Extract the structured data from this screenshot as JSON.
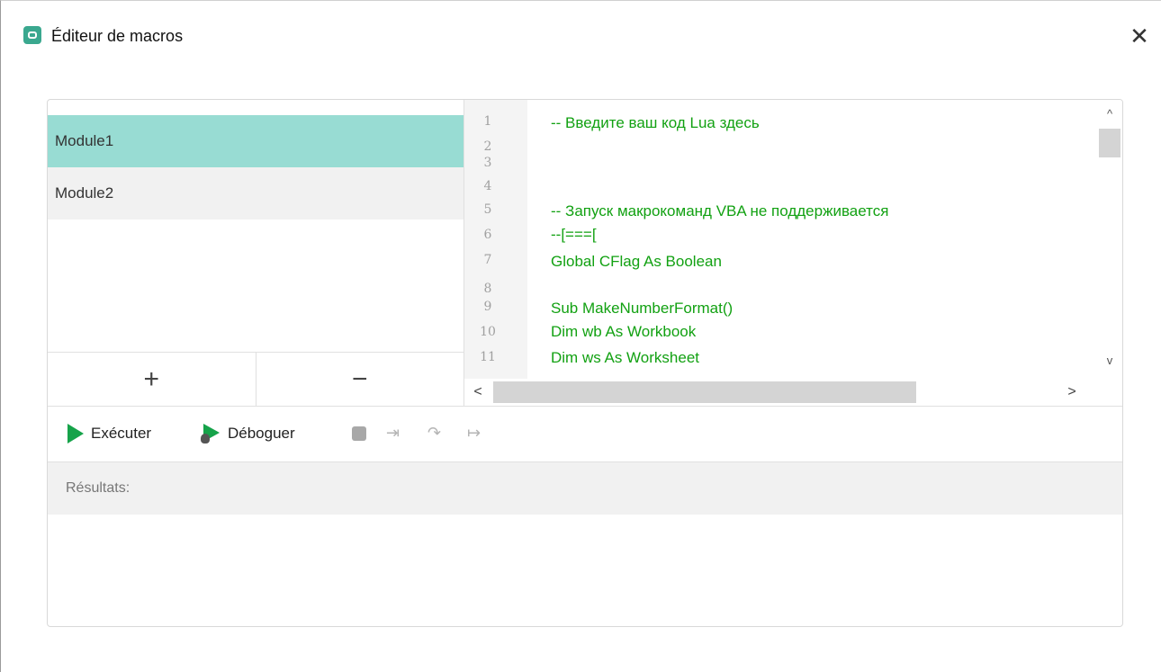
{
  "window": {
    "title": "Éditeur de macros",
    "close_glyph": "✕"
  },
  "modules": [
    {
      "label": "Module1"
    },
    {
      "label": "Module2"
    }
  ],
  "module_buttons": {
    "add": "+",
    "remove": "−"
  },
  "editor": {
    "lines": [
      {
        "n": "1",
        "code": "-- Введите ваш код Lua здесь"
      },
      {
        "n": "2",
        "code": ""
      },
      {
        "n": "3",
        "code": ""
      },
      {
        "n": "4",
        "code": ""
      },
      {
        "n": "5",
        "code": "-- Запуск макрокоманд VBA не поддерживается"
      },
      {
        "n": "6",
        "code": "--[===["
      },
      {
        "n": "7",
        "code": "Global CFlag As Boolean"
      },
      {
        "n": "8",
        "code": ""
      },
      {
        "n": "9",
        "code": "Sub MakeNumberFormat()"
      },
      {
        "n": "10",
        "code": "Dim wb As Workbook"
      },
      {
        "n": "11",
        "code": "Dim ws As Worksheet"
      }
    ],
    "scroll_up": "^",
    "scroll_down": "v",
    "scroll_left": "<",
    "scroll_right": ">"
  },
  "toolbar": {
    "run_label": "Exécuter",
    "debug_label": "Déboguer",
    "step_into_glyph": "⇥",
    "step_over_glyph": "↷",
    "step_out_glyph": "↦"
  },
  "results": {
    "label": "Résultats:"
  },
  "colors": {
    "accent": "#98dcd3",
    "code_green": "#12a112",
    "run_green": "#16a34a"
  }
}
